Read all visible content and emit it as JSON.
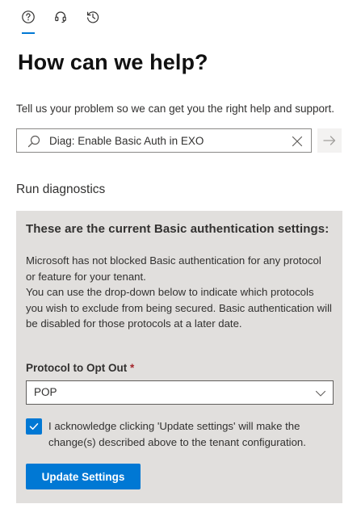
{
  "tabs": [
    {
      "icon": "help-icon",
      "selected": true
    },
    {
      "icon": "headset-icon",
      "selected": false
    },
    {
      "icon": "history-icon",
      "selected": false
    }
  ],
  "page": {
    "title": "How can we help?",
    "intro": "Tell us your problem so we can get you the right help and support."
  },
  "search": {
    "value": "Diag: Enable Basic Auth in EXO",
    "icons": {
      "search": "search-icon",
      "clear": "close-icon",
      "submit": "arrow-right-icon"
    }
  },
  "section": {
    "title": "Run diagnostics"
  },
  "panel": {
    "heading": "These are the current Basic authentication settings:",
    "paragraphs": [
      "Microsoft has not blocked Basic authentication for any protocol or feature for your tenant.",
      "You can use the drop-down below to indicate which protocols you wish to exclude from being secured. Basic authentication will be disabled for those protocols at a later date."
    ],
    "field_label": "Protocol to Opt Out",
    "required_mark": "*",
    "dropdown_value": "POP",
    "checkbox_checked": true,
    "acknowledge_text": "I acknowledge clicking 'Update settings' will make the change(s) described above to the tenant configuration.",
    "button_label": "Update Settings"
  },
  "colors": {
    "accent": "#0078d4",
    "panel_background": "#e1dfdd",
    "required": "#a4262c"
  }
}
